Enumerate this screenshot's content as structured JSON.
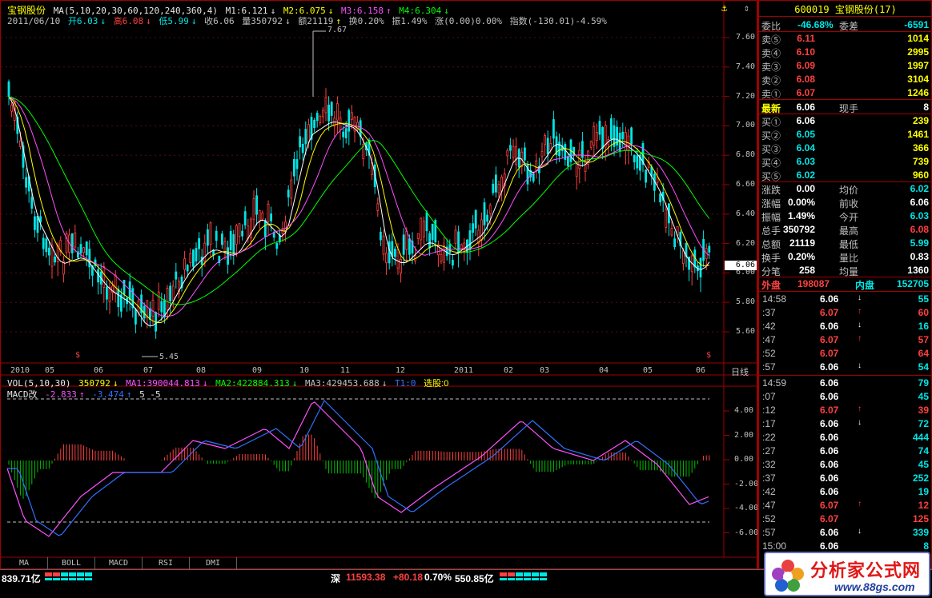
{
  "stock": {
    "name": "宝钢股份",
    "code": "600019",
    "rank": "(17)"
  },
  "ma_header": {
    "label": "MA(5,10,20,30,60,120,240,360,4)",
    "m1": "M1:6.121",
    "m2": "M2:6.075",
    "m3": "M3:6.158",
    "m4": "M4:6.304"
  },
  "day_header": {
    "date": "2011/06/10",
    "open": "开6.03",
    "high": "高6.08",
    "low": "低5.99",
    "close": "收6.06",
    "volume": "量350792",
    "amount": "额21119",
    "turnover": "换0.20%",
    "amplitude": "振1.49%",
    "change": "涨(0.00)0.00%",
    "index": "指数(-130.01)-4.59%"
  },
  "price_axis": [
    "7.60",
    "7.40",
    "7.20",
    "7.00",
    "6.80",
    "6.60",
    "6.40",
    "6.20",
    "6.00",
    "5.80",
    "5.60"
  ],
  "price_marker": "6.06",
  "annotations": {
    "high": "7.67",
    "low": "5.45"
  },
  "months": [
    "2010",
    "05",
    "06",
    "07",
    "08",
    "09",
    "10",
    "11",
    "12",
    "2011",
    "02",
    "03",
    "04",
    "05",
    "06"
  ],
  "period_label": "日线",
  "vol_header": {
    "label": "VOL(5,10,30)",
    "vol": "350792",
    "ma1": "MA1:390044.813",
    "ma2": "MA2:422884.313",
    "ma3": "MA3:429453.688",
    "t1": "T1:0",
    "select": "选股:0"
  },
  "macd_header": {
    "label": "MACD改",
    "v1": "-2.833",
    "v2": "-3.474",
    "params": "5 -5"
  },
  "macd_axis": [
    "4.00",
    "2.00",
    "0.00",
    "-2.00",
    "-4.00",
    "-6.00"
  ],
  "tabs": [
    "MA",
    "BOLL",
    "MACD",
    "RSI",
    "DMI"
  ],
  "quote": {
    "weibi_label": "委比",
    "weibi": "-46.68%",
    "weicha_label": "委差",
    "weicha": "-6591",
    "asks": [
      {
        "label": "卖⑤",
        "price": "6.11",
        "vol": "1014"
      },
      {
        "label": "卖④",
        "price": "6.10",
        "vol": "2995"
      },
      {
        "label": "卖③",
        "price": "6.09",
        "vol": "1997"
      },
      {
        "label": "卖②",
        "price": "6.08",
        "vol": "3104"
      },
      {
        "label": "卖①",
        "price": "6.07",
        "vol": "1246"
      }
    ],
    "last_label": "最新",
    "last": "6.06",
    "xianshou_label": "现手",
    "xianshou": "8",
    "bids": [
      {
        "label": "买①",
        "price": "6.06",
        "vol": "239"
      },
      {
        "label": "买②",
        "price": "6.05",
        "vol": "1461"
      },
      {
        "label": "买③",
        "price": "6.04",
        "vol": "366"
      },
      {
        "label": "买④",
        "price": "6.03",
        "vol": "739"
      },
      {
        "label": "买⑤",
        "price": "6.02",
        "vol": "960"
      }
    ],
    "stats": [
      {
        "l1": "涨跌",
        "v1": "0.00",
        "c1": "#ffffff",
        "l2": "均价",
        "v2": "6.02",
        "c2": "#00e5e5"
      },
      {
        "l1": "涨幅",
        "v1": "0.00%",
        "c1": "#ffffff",
        "l2": "前收",
        "v2": "6.06",
        "c2": "#ffffff"
      },
      {
        "l1": "振幅",
        "v1": "1.49%",
        "c1": "#ffffff",
        "l2": "今开",
        "v2": "6.03",
        "c2": "#00e5e5"
      },
      {
        "l1": "总手",
        "v1": "350792",
        "c1": "#ffffff",
        "l2": "最高",
        "v2": "6.08",
        "c2": "#ff4040"
      },
      {
        "l1": "总额",
        "v1": "21119",
        "c1": "#ffffff",
        "l2": "最低",
        "v2": "5.99",
        "c2": "#00e5e5"
      },
      {
        "l1": "换手",
        "v1": "0.20%",
        "c1": "#ffffff",
        "l2": "量比",
        "v2": "0.83",
        "c2": "#ffffff"
      },
      {
        "l1": "分笔",
        "v1": "258",
        "c1": "#ffffff",
        "l2": "均量",
        "v2": "1360",
        "c2": "#ffffff"
      }
    ],
    "waipan_label": "外盘",
    "waipan": "198087",
    "neipan_label": "内盘",
    "neipan": "152705"
  },
  "ticks": [
    {
      "time": "14:58",
      "price": "6.06",
      "arrow": "↓",
      "vol": "55",
      "pc": "#ffffff",
      "vc": "#00e5e5"
    },
    {
      "time": ":37",
      "price": "6.07",
      "arrow": "↑",
      "vol": "60",
      "pc": "#ff4040",
      "vc": "#ff4040"
    },
    {
      "time": ":42",
      "price": "6.06",
      "arrow": "↓",
      "vol": "16",
      "pc": "#ffffff",
      "vc": "#00e5e5"
    },
    {
      "time": ":47",
      "price": "6.07",
      "arrow": "↑",
      "vol": "57",
      "pc": "#ff4040",
      "vc": "#ff4040"
    },
    {
      "time": ":52",
      "price": "6.07",
      "arrow": "",
      "vol": "64",
      "pc": "#ff4040",
      "vc": "#ff4040"
    },
    {
      "time": ":57",
      "price": "6.06",
      "arrow": "↓",
      "vol": "54",
      "pc": "#ffffff",
      "vc": "#00e5e5"
    },
    {
      "time": "14:59",
      "price": "6.06",
      "arrow": "",
      "vol": "79",
      "pc": "#ffffff",
      "vc": "#00e5e5"
    },
    {
      "time": ":07",
      "price": "6.06",
      "arrow": "",
      "vol": "45",
      "pc": "#ffffff",
      "vc": "#00e5e5"
    },
    {
      "time": ":12",
      "price": "6.07",
      "arrow": "↑",
      "vol": "39",
      "pc": "#ff4040",
      "vc": "#ff4040"
    },
    {
      "time": ":17",
      "price": "6.06",
      "arrow": "↓",
      "vol": "72",
      "pc": "#ffffff",
      "vc": "#00e5e5"
    },
    {
      "time": ":22",
      "price": "6.06",
      "arrow": "",
      "vol": "444",
      "pc": "#ffffff",
      "vc": "#00e5e5"
    },
    {
      "time": ":27",
      "price": "6.06",
      "arrow": "",
      "vol": "74",
      "pc": "#ffffff",
      "vc": "#00e5e5"
    },
    {
      "time": ":32",
      "price": "6.06",
      "arrow": "",
      "vol": "45",
      "pc": "#ffffff",
      "vc": "#00e5e5"
    },
    {
      "time": ":37",
      "price": "6.06",
      "arrow": "",
      "vol": "252",
      "pc": "#ffffff",
      "vc": "#00e5e5"
    },
    {
      "time": ":42",
      "price": "6.06",
      "arrow": "",
      "vol": "19",
      "pc": "#ffffff",
      "vc": "#00e5e5"
    },
    {
      "time": ":47",
      "price": "6.07",
      "arrow": "↑",
      "vol": "12",
      "pc": "#ff4040",
      "vc": "#ff4040"
    },
    {
      "time": ":52",
      "price": "6.07",
      "arrow": "",
      "vol": "125",
      "pc": "#ff4040",
      "vc": "#ff4040"
    },
    {
      "time": ":57",
      "price": "6.06",
      "arrow": "↓",
      "vol": "339",
      "pc": "#ffffff",
      "vc": "#00e5e5"
    },
    {
      "time": "15:00",
      "price": "6.06",
      "arrow": "",
      "vol": "8",
      "pc": "#ffffff",
      "vc": "#00e5e5"
    }
  ],
  "status": {
    "left_amount": "839.71亿",
    "sz_label": "深",
    "sz_index": "11593.38",
    "sz_change": "+80.18",
    "sz_pct": "0.70%",
    "sz_amount": "550.85亿"
  },
  "watermark": {
    "title": "分析家公式网",
    "url": "www.88gs.com"
  },
  "colors": {
    "up": "#ff4040",
    "down": "#00e5e5",
    "ma1": "#ffffff",
    "ma2": "#ffff00",
    "ma3": "#ff50ff",
    "ma4": "#00ff00",
    "frame": "#a00000"
  }
}
